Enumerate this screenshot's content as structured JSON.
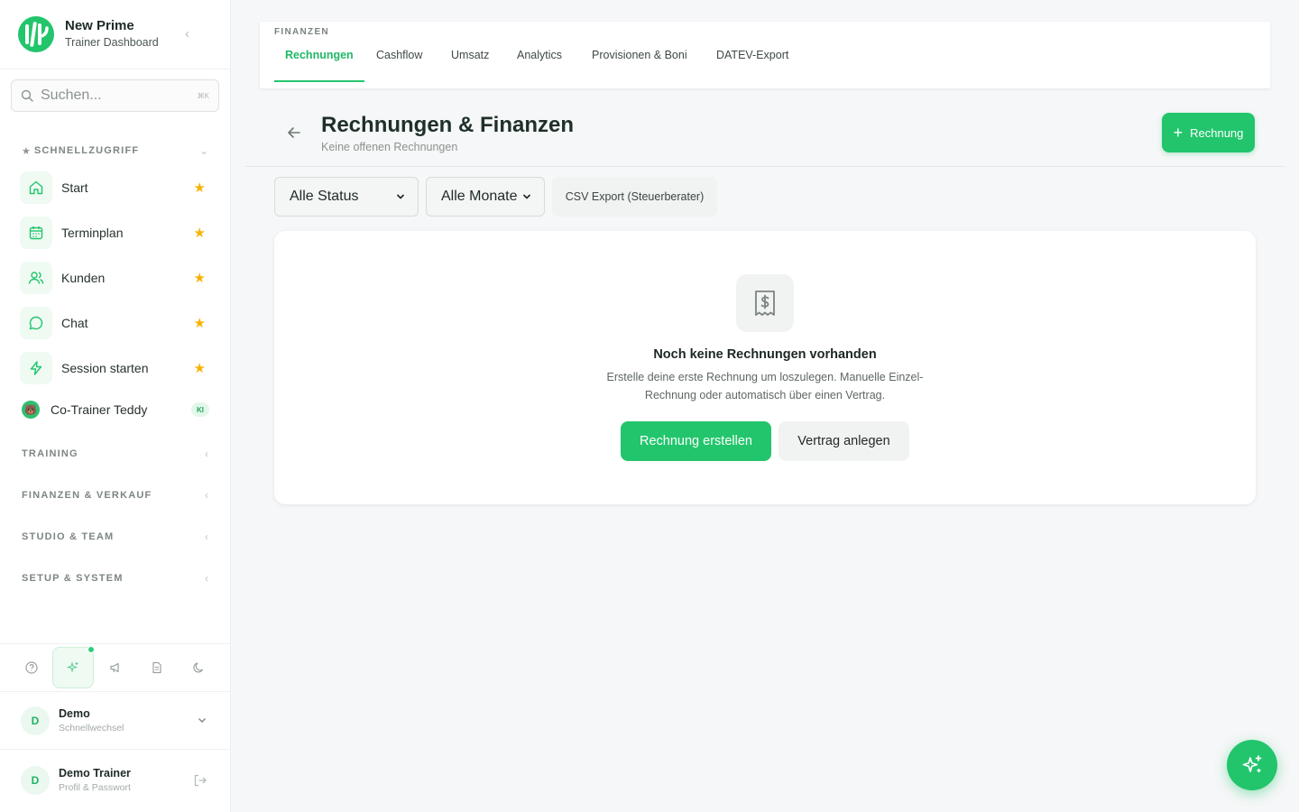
{
  "brand": {
    "title": "New Prime",
    "subtitle": "Trainer Dashboard"
  },
  "search": {
    "placeholder": "Suchen...",
    "shortcut": "⌘K"
  },
  "sidebar": {
    "quick_title": "SCHNELLZUGRIFF",
    "quick_items": [
      {
        "label": "Start",
        "icon": "home-icon"
      },
      {
        "label": "Terminplan",
        "icon": "calendar-icon"
      },
      {
        "label": "Kunden",
        "icon": "users-icon"
      },
      {
        "label": "Chat",
        "icon": "chat-bubble-icon"
      },
      {
        "label": "Session starten",
        "icon": "lightning-icon"
      }
    ],
    "cotrainer": {
      "label": "Co-Trainer Teddy",
      "badge": "KI",
      "avatar": "🐻"
    },
    "sections": [
      "TRAINING",
      "FINANZEN & VERKAUF",
      "STUDIO & TEAM",
      "SETUP & SYSTEM"
    ],
    "footer_icons": [
      "help-icon",
      "sparkles-icon",
      "megaphone-icon",
      "document-icon",
      "moon-icon"
    ]
  },
  "account_switcher": {
    "initial": "D",
    "name": "Demo",
    "subtitle": "Schnellwechsel"
  },
  "user": {
    "initial": "D",
    "name": "Demo Trainer",
    "subtitle": "Profil & Passwort"
  },
  "tabs": {
    "eyebrow": "FINANZEN",
    "items": [
      "Rechnungen",
      "Cashflow",
      "Umsatz",
      "Analytics",
      "Provisionen & Boni",
      "DATEV-Export"
    ],
    "active": "Rechnungen"
  },
  "header": {
    "title": "Rechnungen & Finanzen",
    "subtitle": "Keine offenen Rechnungen",
    "new_button": "Rechnung"
  },
  "filters": {
    "status": "Alle Status",
    "month": "Alle Monate",
    "csv_button": "CSV Export (Steuerberater)"
  },
  "empty_state": {
    "title": "Noch keine Rechnungen vorhanden",
    "description": "Erstelle deine erste Rechnung um loszulegen. Manuelle Einzel-Rechnung oder automatisch über einen Vertrag.",
    "primary_button": "Rechnung erstellen",
    "secondary_button": "Vertrag anlegen"
  },
  "colors": {
    "accent": "#22c56c",
    "star": "#f5b301"
  }
}
